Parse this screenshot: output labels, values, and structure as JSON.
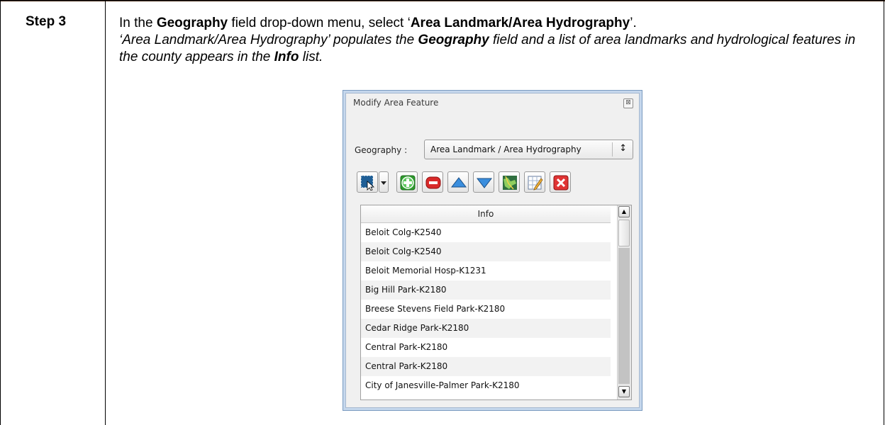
{
  "step": {
    "label": "Step 3"
  },
  "instruction": {
    "line1_pre": "In the ",
    "line1_b1": "Geography",
    "line1_mid": " field drop-down menu, select ‘",
    "line1_b2": "Area Landmark/Area Hydrography",
    "line1_post": "’.",
    "line2_pre": "‘Area Landmark/Area Hydrography’ populates the ",
    "line2_b1": "Geography",
    "line2_mid": " field and a list of area landmarks and hydrological features in the county appears in the ",
    "line2_b2": "Info",
    "line2_post": " list."
  },
  "dialog": {
    "title": "Modify Area Feature",
    "close_glyph": "⊠",
    "geography_label": "Geography :",
    "geography_value": "Area Landmark / Area Hydrography",
    "select_arrow": "↕",
    "toolbar_icons": [
      "select-icon",
      "dropdown-icon",
      "add-icon",
      "remove-icon",
      "move-up-icon",
      "move-down-icon",
      "map-icon",
      "edit-icon",
      "delete-icon"
    ],
    "list_header": "Info",
    "rows": [
      "Beloit Colg-K2540",
      "Beloit Colg-K2540",
      "Beloit Memorial Hosp-K1231",
      "Big Hill Park-K2180",
      "Breese Stevens Field Park-K2180",
      "Cedar Ridge Park-K2180",
      "Central Park-K2180",
      "Central Park-K2180",
      "City of Janesville-Palmer Park-K2180"
    ],
    "scroll_up": "▲",
    "scroll_down": "▼"
  }
}
